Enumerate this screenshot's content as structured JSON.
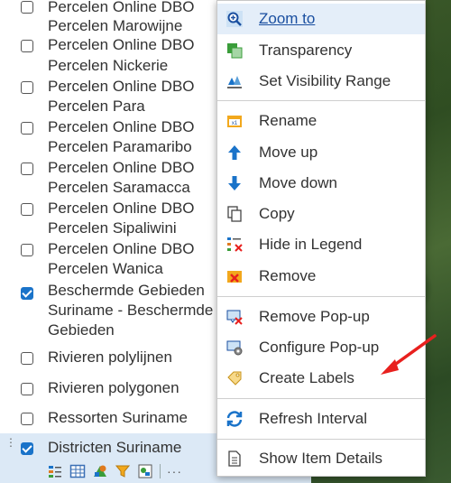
{
  "layers": [
    {
      "label": "Percelen Online DBO",
      "checked": false
    },
    {
      "label": "Percelen Marowijne",
      "checked": null
    },
    {
      "label": "Percelen Online DBO",
      "checked": false
    },
    {
      "label": "Percelen Nickerie",
      "checked": null
    },
    {
      "label": "Percelen Online DBO",
      "checked": false
    },
    {
      "label": "Percelen Para",
      "checked": null
    },
    {
      "label": "Percelen Online DBO",
      "checked": false
    },
    {
      "label": "Percelen Paramaribo",
      "checked": null
    },
    {
      "label": "Percelen Online DBO",
      "checked": false
    },
    {
      "label": "Percelen Saramacca",
      "checked": null
    },
    {
      "label": "Percelen Online DBO",
      "checked": false
    },
    {
      "label": "Percelen Sipaliwini",
      "checked": null
    },
    {
      "label": "Percelen Online DBO",
      "checked": false
    },
    {
      "label": "Percelen Wanica",
      "checked": null
    },
    {
      "label": "Beschermde Gebieden",
      "checked": true
    },
    {
      "label": "Suriname - Beschermde",
      "checked": null
    },
    {
      "label": "Gebieden",
      "checked": null
    },
    {
      "label": "Rivieren polylijnen",
      "checked": false
    },
    {
      "label": "Rivieren polygonen",
      "checked": false
    },
    {
      "label": "Ressorten Suriname",
      "checked": false
    },
    {
      "label": "Districten Suriname",
      "checked": true
    }
  ],
  "context_menu": {
    "items": [
      {
        "label": "Zoom to",
        "icon": "zoom-to-icon"
      },
      {
        "label": "Transparency",
        "icon": "transparency-icon"
      },
      {
        "label": "Set Visibility Range",
        "icon": "visibility-range-icon"
      },
      {
        "label": "Rename",
        "icon": "rename-icon"
      },
      {
        "label": "Move up",
        "icon": "arrow-up-icon"
      },
      {
        "label": "Move down",
        "icon": "arrow-down-icon"
      },
      {
        "label": "Copy",
        "icon": "copy-icon"
      },
      {
        "label": "Hide in Legend",
        "icon": "hide-legend-icon"
      },
      {
        "label": "Remove",
        "icon": "remove-icon"
      },
      {
        "label": "Remove Pop-up",
        "icon": "remove-popup-icon"
      },
      {
        "label": "Configure Pop-up",
        "icon": "configure-popup-icon"
      },
      {
        "label": "Create Labels",
        "icon": "create-labels-icon"
      },
      {
        "label": "Refresh Interval",
        "icon": "refresh-icon"
      },
      {
        "label": "Show Item Details",
        "icon": "item-details-icon"
      }
    ]
  },
  "colors": {
    "accent": "#1a73c9",
    "annotation_arrow": "#e8201e"
  }
}
